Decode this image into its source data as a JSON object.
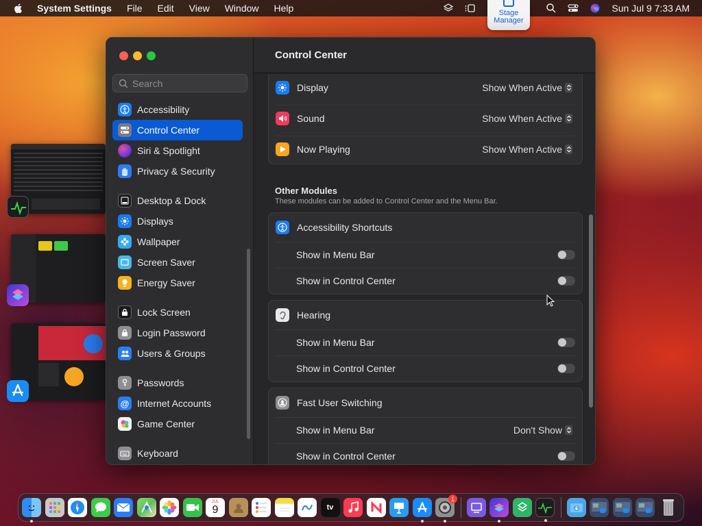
{
  "menubar": {
    "app_name": "System Settings",
    "menus": [
      "File",
      "Edit",
      "View",
      "Window",
      "Help"
    ],
    "datetime": "Sun Jul 9  7:33 AM",
    "stage_manager_popup": "Stage Manager"
  },
  "window": {
    "title": "Control Center",
    "search_placeholder": "Search"
  },
  "sidebar": {
    "groups": [
      [
        {
          "label": "Accessibility",
          "icon": "accessibility-icon",
          "color": "#1a7cf0"
        },
        {
          "label": "Control Center",
          "icon": "control-center-icon",
          "color": "#7b7b80",
          "active": true
        },
        {
          "label": "Siri & Spotlight",
          "icon": "siri-icon",
          "color": "#b44be0"
        },
        {
          "label": "Privacy & Security",
          "icon": "hand-icon",
          "color": "#2a7df2"
        }
      ],
      [
        {
          "label": "Desktop & Dock",
          "icon": "dock-icon",
          "color": "#1c1c1e"
        },
        {
          "label": "Displays",
          "icon": "sun-icon",
          "color": "#1a7cf0"
        },
        {
          "label": "Wallpaper",
          "icon": "flower-icon",
          "color": "#36a9f0"
        },
        {
          "label": "Screen Saver",
          "icon": "screensaver-icon",
          "color": "#48b8e8"
        },
        {
          "label": "Energy Saver",
          "icon": "bulb-icon",
          "color": "#f5b21a"
        }
      ],
      [
        {
          "label": "Lock Screen",
          "icon": "lock-icon",
          "color": "#1c1c1e"
        },
        {
          "label": "Login Password",
          "icon": "padlock-icon",
          "color": "#8e8e93"
        },
        {
          "label": "Users & Groups",
          "icon": "users-icon",
          "color": "#2a7df2"
        }
      ],
      [
        {
          "label": "Passwords",
          "icon": "key-icon",
          "color": "#8e8e93"
        },
        {
          "label": "Internet Accounts",
          "icon": "at-icon",
          "color": "#2a7df2"
        },
        {
          "label": "Game Center",
          "icon": "game-center-icon",
          "color": "#e8e8e8"
        }
      ],
      [
        {
          "label": "Keyboard",
          "icon": "keyboard-icon",
          "color": "#8e8e93"
        }
      ]
    ]
  },
  "modules_top": [
    {
      "label": "Display",
      "icon": "sun-icon",
      "color": "#1a7cf0",
      "value": "Show When Active"
    },
    {
      "label": "Sound",
      "icon": "speaker-icon",
      "color": "#f03a5a",
      "value": "Show When Active"
    },
    {
      "label": "Now Playing",
      "icon": "play-icon",
      "color": "#f5a623",
      "value": "Show When Active"
    }
  ],
  "other_modules": {
    "title": "Other Modules",
    "subtitle": "These modules can be added to Control Center and the Menu Bar.",
    "cards": [
      {
        "label": "Accessibility Shortcuts",
        "icon": "accessibility-icon",
        "color": "#1a7cf0",
        "rows": [
          {
            "label": "Show in Menu Bar",
            "type": "toggle",
            "on": false
          },
          {
            "label": "Show in Control Center",
            "type": "toggle",
            "on": false
          }
        ]
      },
      {
        "label": "Hearing",
        "icon": "ear-icon",
        "color": "#e8e8e8",
        "rows": [
          {
            "label": "Show in Menu Bar",
            "type": "toggle",
            "on": false
          },
          {
            "label": "Show in Control Center",
            "type": "toggle",
            "on": false
          }
        ]
      },
      {
        "label": "Fast User Switching",
        "icon": "user-icon",
        "color": "#8e8e93",
        "rows": [
          {
            "label": "Show in Menu Bar",
            "type": "select",
            "value": "Don't Show"
          },
          {
            "label": "Show in Control Center",
            "type": "toggle",
            "on": false
          }
        ]
      }
    ]
  },
  "dock": {
    "apps": [
      {
        "name": "finder-icon",
        "color": "#2f8cf0",
        "running": true
      },
      {
        "name": "launchpad-icon",
        "color": "#c8c8cc"
      },
      {
        "name": "safari-icon",
        "color": "#1e90f0"
      },
      {
        "name": "messages-icon",
        "color": "#3ccb4a"
      },
      {
        "name": "mail-icon",
        "color": "#2a7df2"
      },
      {
        "name": "maps-icon",
        "color": "#5cc05a"
      },
      {
        "name": "photos-icon",
        "color": "#f2f2f2"
      },
      {
        "name": "facetime-icon",
        "color": "#35c24a"
      },
      {
        "name": "calendar-icon",
        "color": "#ffffff",
        "text": "9"
      },
      {
        "name": "contacts-icon",
        "color": "#b8905a"
      },
      {
        "name": "reminders-icon",
        "color": "#f4f4f4"
      },
      {
        "name": "notes-icon",
        "color": "#f7d84a"
      },
      {
        "name": "freeform-icon",
        "color": "#f4f4f4"
      },
      {
        "name": "tv-icon",
        "color": "#111111",
        "text": "tv"
      },
      {
        "name": "music-icon",
        "color": "#fa3c55"
      },
      {
        "name": "news-icon",
        "color": "#f2f2f2"
      },
      {
        "name": "keynote-icon",
        "color": "#2a9cf0"
      },
      {
        "name": "app-store-icon",
        "color": "#1a8cf5",
        "running": true
      },
      {
        "name": "system-settings-icon",
        "color": "#8e8e93",
        "running": true,
        "badge": "1"
      }
    ],
    "apps_2": [
      {
        "name": "screen-recorder-icon",
        "color": "#7a5ae0"
      },
      {
        "name": "shortcuts-icon",
        "color": "#5b4be8",
        "running": true
      },
      {
        "name": "transfer-icon",
        "color": "#2fb56a"
      },
      {
        "name": "activity-monitor-icon",
        "color": "#1c1c1e",
        "running": true
      }
    ],
    "apps_3": [
      {
        "name": "downloads-folder-icon",
        "color": "#4aa6e8"
      },
      {
        "name": "recent-item-1-icon",
        "color": "#3a4a6a"
      },
      {
        "name": "recent-item-2-icon",
        "color": "#3a4a6a"
      },
      {
        "name": "recent-item-3-icon",
        "color": "#3a4a6a"
      },
      {
        "name": "trash-icon",
        "color": "#9a9a9e"
      }
    ]
  }
}
